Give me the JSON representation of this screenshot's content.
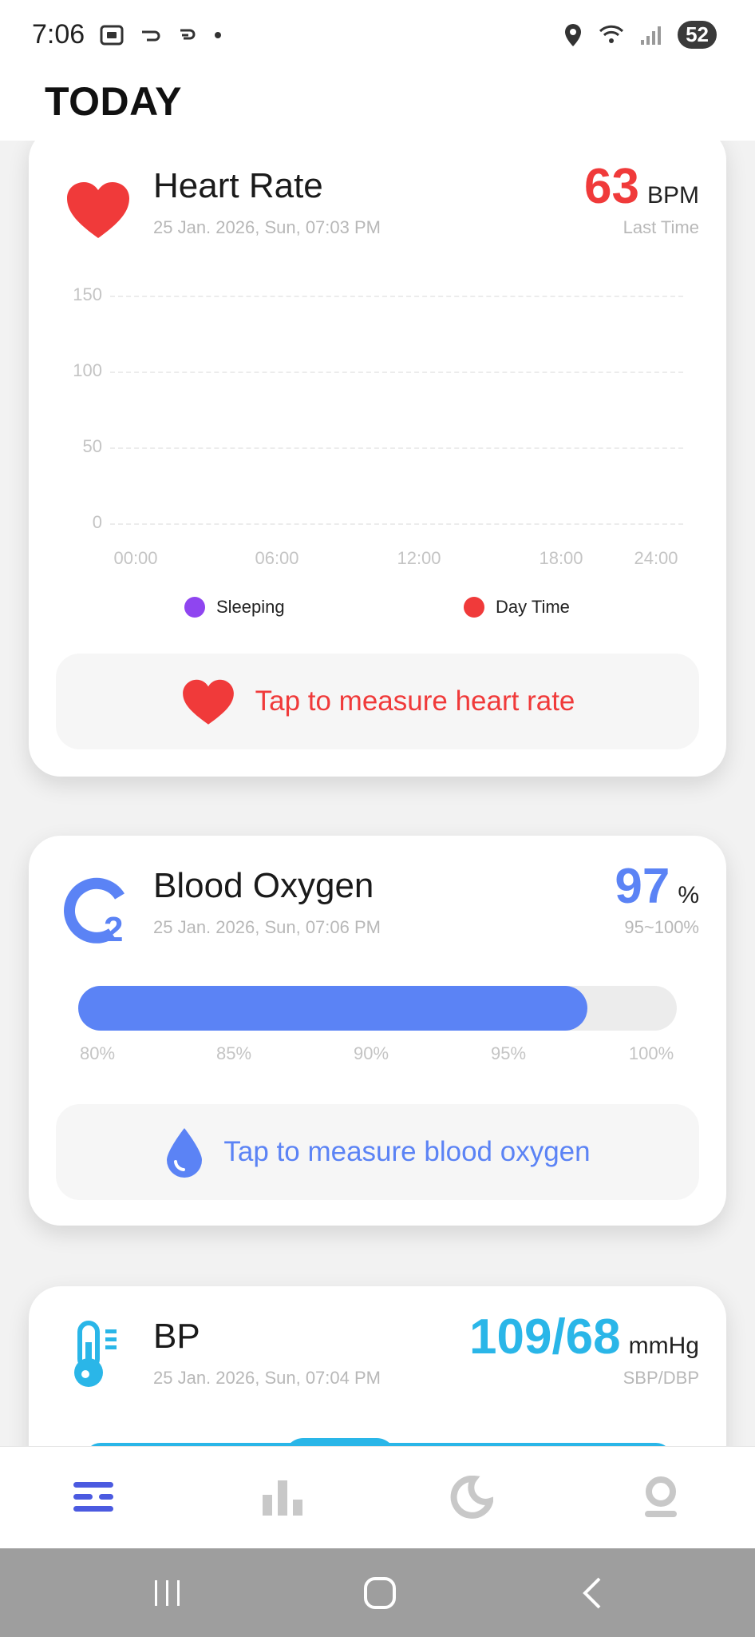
{
  "status_bar": {
    "time": "7:06",
    "battery": "52"
  },
  "header": {
    "title": "TODAY"
  },
  "heart_rate": {
    "title": "Heart Rate",
    "date": "25 Jan. 2026, Sun, 07:03 PM",
    "value": "63",
    "unit": "BPM",
    "sub": "Last Time",
    "color": "#f03a3a",
    "y_labels": [
      "150",
      "100",
      "50",
      "0"
    ],
    "x_labels": [
      "00:00",
      "06:00",
      "12:00",
      "18:00",
      "24:00"
    ],
    "legend": [
      {
        "label": "Sleeping",
        "color": "#8f45f0"
      },
      {
        "label": "Day Time",
        "color": "#f03a3a"
      }
    ],
    "measure_label": "Tap to measure heart rate"
  },
  "blood_oxygen": {
    "title": "Blood Oxygen",
    "date": "25 Jan. 2026, Sun, 07:06 PM",
    "value": "97",
    "unit": "%",
    "sub": "95~100%",
    "color": "#5b83f5",
    "level_percent": 97,
    "scale_labels": [
      "80%",
      "85%",
      "90%",
      "95%",
      "100%"
    ],
    "measure_label": "Tap to measure blood oxygen"
  },
  "bp": {
    "title": "BP",
    "date": "25 Jan. 2026, Sun, 07:04 PM",
    "value": "109/68",
    "unit": "mmHg",
    "sub": "SBP/DBP",
    "color": "#2ab6e8"
  },
  "bottom_nav": {
    "items": [
      {
        "icon": "today-list-icon",
        "active": true
      },
      {
        "icon": "stats-bar-icon",
        "active": false
      },
      {
        "icon": "sleep-moon-icon",
        "active": false
      },
      {
        "icon": "profile-icon",
        "active": false
      }
    ],
    "active_color": "#4b5ae0",
    "inactive_color": "#c8c8c8"
  }
}
